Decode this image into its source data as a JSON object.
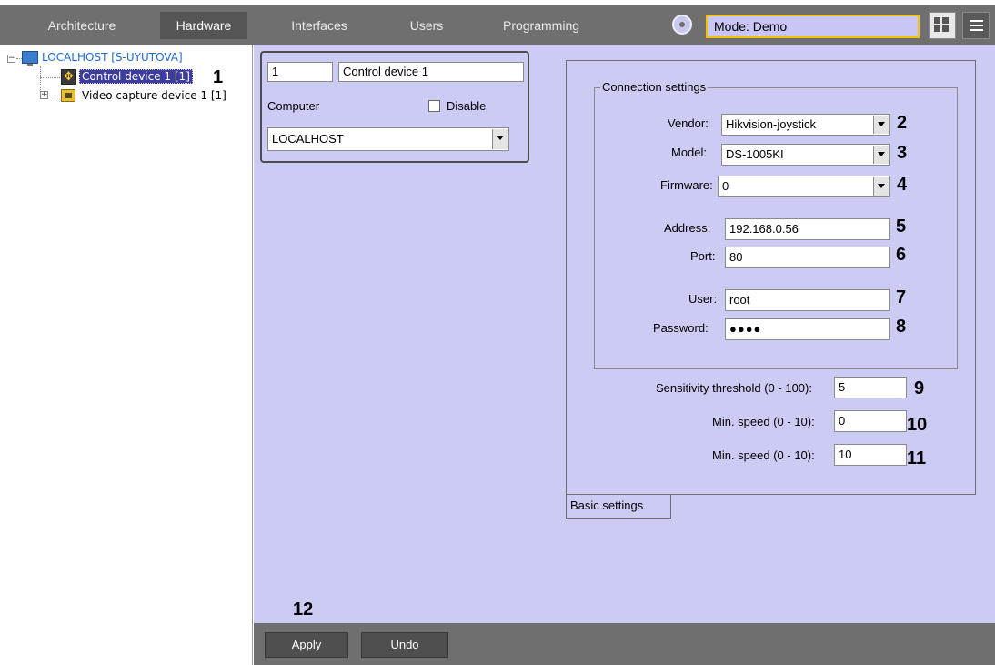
{
  "top_menu": {
    "tabs": [
      {
        "label": "Architecture"
      },
      {
        "label": "Hardware",
        "active": true
      },
      {
        "label": "Interfaces"
      },
      {
        "label": "Users"
      },
      {
        "label": "Programming"
      }
    ],
    "mode_label": "Mode: Demo",
    "icons": [
      "mode-icon",
      "layout-grid-icon",
      "menu-icon"
    ]
  },
  "tree": {
    "root_label": "LOCALHOST [S-UYUTOVA]",
    "items": [
      {
        "label": "Control device 1 [1]",
        "icon": "control-device-icon",
        "selected": true
      },
      {
        "label": "Video capture device 1 [1]",
        "icon": "video-capture-icon"
      }
    ]
  },
  "object": {
    "id": "1",
    "name": "Control device 1",
    "computer_label": "Computer",
    "disable_label": "Disable",
    "disable_checked": false,
    "computer_value": "LOCALHOST"
  },
  "connection": {
    "group_title": "Connection settings",
    "vendor_label": "Vendor:",
    "vendor_value": "Hikvision-joystick",
    "model_label": "Model:",
    "model_value": "DS-1005KI",
    "firmware_label": "Firmware:",
    "firmware_value": "0",
    "address_label": "Address:",
    "address_value": "192.168.0.56",
    "port_label": "Port:",
    "port_value": "80",
    "user_label": "User:",
    "user_value": "root",
    "password_label": "Password:",
    "password_value": "●●●●"
  },
  "thresholds": {
    "sensitivity_label": "Sensitivity threshold (0 - 100):",
    "sensitivity_value": "5",
    "min_speed_label": "Min. speed (0 - 10):",
    "min_speed_value": "0",
    "max_speed_label": "Min. speed (0 - 10):",
    "max_speed_value": "10"
  },
  "tabs_bottom": {
    "basic": "Basic settings"
  },
  "buttons": {
    "apply": "Apply",
    "undo_prefix": "U",
    "undo_rest": "ndo"
  },
  "callouts": [
    "1",
    "2",
    "3",
    "4",
    "5",
    "6",
    "7",
    "8",
    "9",
    "10",
    "11",
    "12"
  ],
  "colors": {
    "top_bar": "#6f6f6f",
    "panel": "#cccbf4",
    "mode_border": "#f5c200",
    "selected": "#3d3d9d"
  }
}
